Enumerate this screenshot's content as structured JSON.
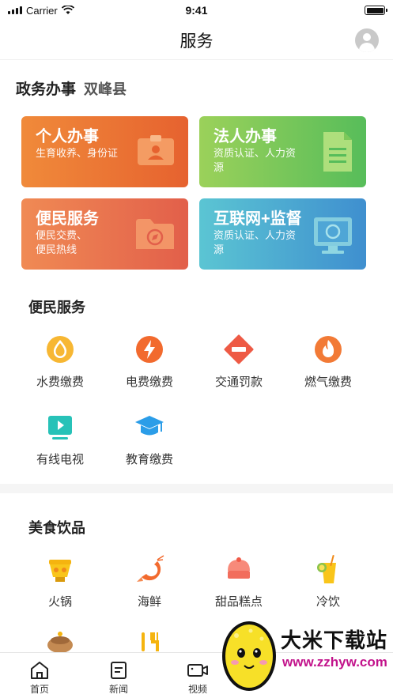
{
  "status_bar": {
    "carrier": "Carrier",
    "time": "9:41"
  },
  "nav": {
    "title": "服务"
  },
  "gov": {
    "title": "政务办事",
    "county": "双峰县"
  },
  "cards": [
    {
      "title": "个人办事",
      "subtitle": "生育收养、身份证",
      "icon": "id-card-icon"
    },
    {
      "title": "法人办事",
      "subtitle": "资质认证、人力资源",
      "icon": "document-icon"
    },
    {
      "title": "便民服务",
      "subtitle": "便民交费、便民热线",
      "icon": "folder-icon"
    },
    {
      "title": "互联网+监督",
      "subtitle": "资质认证、人力资源",
      "icon": "monitor-icon"
    }
  ],
  "convenience": {
    "title": "便民服务",
    "items": [
      {
        "label": "水费缴费",
        "icon": "water-drop-icon",
        "color": "#f5a623"
      },
      {
        "label": "电费缴费",
        "icon": "lightning-icon",
        "color": "#f26a2e"
      },
      {
        "label": "交通罚款",
        "icon": "no-entry-icon",
        "color": "#ee5a45"
      },
      {
        "label": "燃气缴费",
        "icon": "flame-icon",
        "color": "#f27a36"
      },
      {
        "label": "有线电视",
        "icon": "tv-icon",
        "color": "#27c2b8"
      },
      {
        "label": "教育缴费",
        "icon": "graduation-cap-icon",
        "color": "#2b9de8"
      }
    ]
  },
  "food": {
    "title": "美食饮品",
    "items": [
      {
        "label": "火锅",
        "icon": "hotpot-icon"
      },
      {
        "label": "海鲜",
        "icon": "shrimp-icon"
      },
      {
        "label": "甜品糕点",
        "icon": "cake-icon"
      },
      {
        "label": "冷饮",
        "icon": "cold-drink-icon"
      }
    ]
  },
  "tabbar": [
    {
      "label": "首页",
      "icon": "home-icon"
    },
    {
      "label": "新闻",
      "icon": "news-icon"
    },
    {
      "label": "视频",
      "icon": "video-icon"
    }
  ],
  "watermark": {
    "text": "大米下载站",
    "url": "www.zzhyw.com"
  }
}
